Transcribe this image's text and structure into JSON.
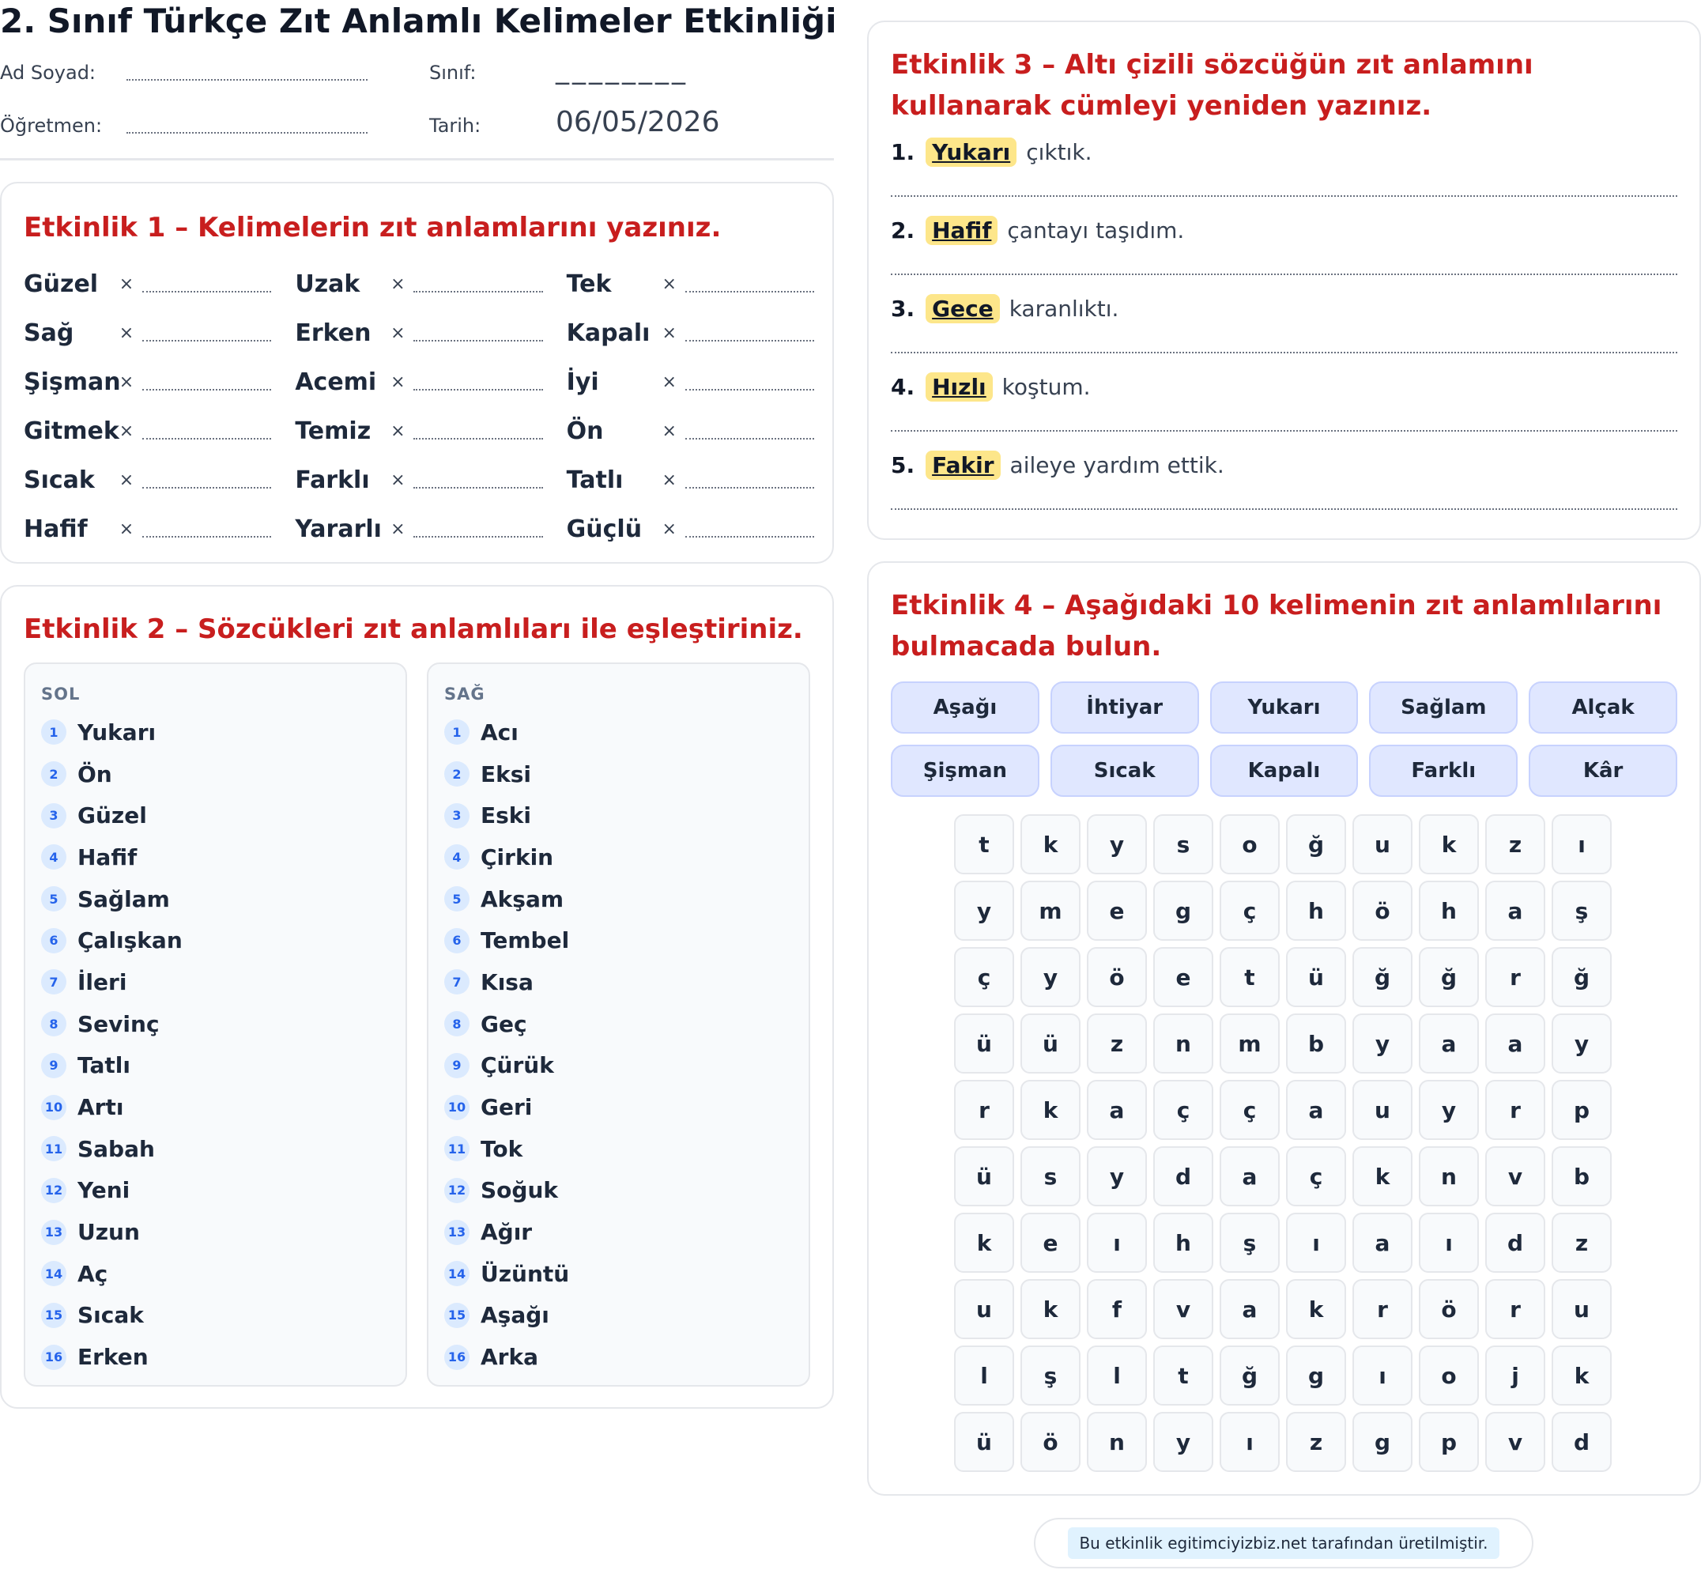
{
  "header": {
    "title": "2. Sınıf Türkçe Zıt Anlamlı Kelimeler Etkinliği",
    "name_label": "Ad Soyad:",
    "class_label": "Sınıf:",
    "class_value": "________",
    "teacher_label": "Öğretmen:",
    "date_label": "Tarih:",
    "date_value": "06/05/2026"
  },
  "activity1": {
    "title": "Etkinlik 1 – Kelimelerin zıt anlamlarını yazınız.",
    "separator": "×",
    "words": [
      "Güzel",
      "Uzak",
      "Tek",
      "Sağ",
      "Erken",
      "Kapalı",
      "Şişman",
      "Acemi",
      "İyi",
      "Gitmek",
      "Temiz",
      "Ön",
      "Sıcak",
      "Farklı",
      "Tatlı",
      "Hafif",
      "Yararlı",
      "Güçlü"
    ]
  },
  "activity2": {
    "title": "Etkinlik 2 – Sözcükleri zıt anlamlıları ile eşleştiriniz.",
    "left_header": "SOL",
    "right_header": "SAĞ",
    "numbers": [
      "1",
      "2",
      "3",
      "4",
      "5",
      "6",
      "7",
      "8",
      "9",
      "10",
      "11",
      "12",
      "13",
      "14",
      "15",
      "16"
    ],
    "left": [
      "Yukarı",
      "Ön",
      "Güzel",
      "Hafif",
      "Sağlam",
      "Çalışkan",
      "İleri",
      "Sevinç",
      "Tatlı",
      "Artı",
      "Sabah",
      "Yeni",
      "Uzun",
      "Aç",
      "Sıcak",
      "Erken"
    ],
    "right": [
      "Acı",
      "Eksi",
      "Eski",
      "Çirkin",
      "Akşam",
      "Tembel",
      "Kısa",
      "Geç",
      "Çürük",
      "Geri",
      "Tok",
      "Soğuk",
      "Ağır",
      "Üzüntü",
      "Aşağı",
      "Arka"
    ]
  },
  "activity3": {
    "title": "Etkinlik 3 – Altı çizili sözcüğün zıt anlamını kullanarak cümleyi yeniden yazınız.",
    "sentences": [
      {
        "num": "1.",
        "word": "Yukarı",
        "rest": "çıktık."
      },
      {
        "num": "2.",
        "word": "Hafif",
        "rest": "çantayı taşıdım."
      },
      {
        "num": "3.",
        "word": "Gece",
        "rest": "karanlıktı."
      },
      {
        "num": "4.",
        "word": "Hızlı",
        "rest": "koştum."
      },
      {
        "num": "5.",
        "word": "Fakir",
        "rest": "aileye yardım ettik."
      }
    ]
  },
  "activity4": {
    "title": "Etkinlik 4 – Aşağıdaki 10 kelimenin zıt anlamlılarını bulmacada bulun.",
    "words": [
      "Aşağı",
      "İhtiyar",
      "Yukarı",
      "Sağlam",
      "Alçak",
      "Şişman",
      "Sıcak",
      "Kapalı",
      "Farklı",
      "Kâr"
    ],
    "grid": [
      [
        "t",
        "k",
        "y",
        "s",
        "o",
        "ğ",
        "u",
        "k",
        "z",
        "ı"
      ],
      [
        "y",
        "m",
        "e",
        "g",
        "ç",
        "h",
        "ö",
        "h",
        "a",
        "ş"
      ],
      [
        "ç",
        "y",
        "ö",
        "e",
        "t",
        "ü",
        "ğ",
        "ğ",
        "r",
        "ğ"
      ],
      [
        "ü",
        "ü",
        "z",
        "n",
        "m",
        "b",
        "y",
        "a",
        "a",
        "y"
      ],
      [
        "r",
        "k",
        "a",
        "ç",
        "ç",
        "a",
        "u",
        "y",
        "r",
        "p"
      ],
      [
        "ü",
        "s",
        "y",
        "d",
        "a",
        "ç",
        "k",
        "n",
        "v",
        "b"
      ],
      [
        "k",
        "e",
        "ı",
        "h",
        "ş",
        "ı",
        "a",
        "ı",
        "d",
        "z"
      ],
      [
        "u",
        "k",
        "f",
        "v",
        "a",
        "k",
        "r",
        "ö",
        "r",
        "u"
      ],
      [
        "l",
        "ş",
        "l",
        "t",
        "ğ",
        "g",
        "ı",
        "o",
        "j",
        "k"
      ],
      [
        "ü",
        "ö",
        "n",
        "y",
        "ı",
        "z",
        "g",
        "p",
        "v",
        "d"
      ]
    ]
  },
  "footer": {
    "text": "Bu etkinlik egitimciyizbiz.net tarafından üretilmiştir."
  }
}
